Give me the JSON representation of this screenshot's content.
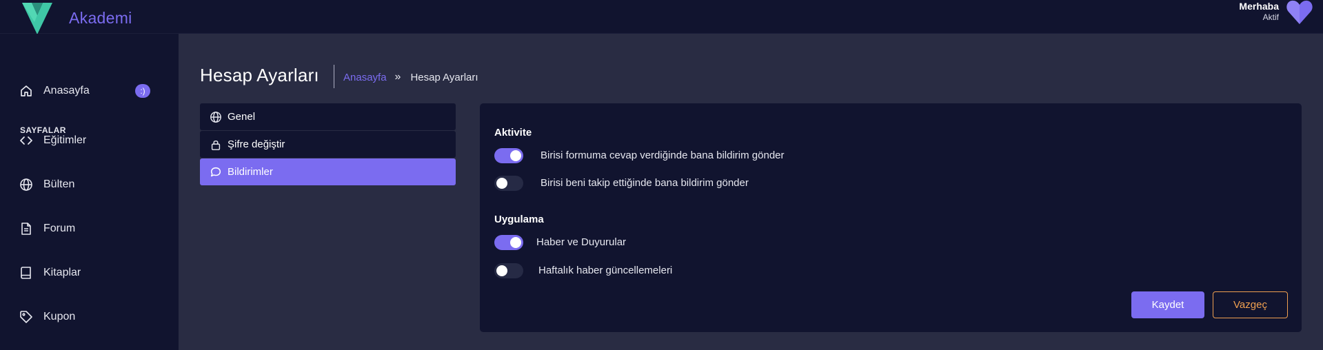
{
  "app": {
    "brand": "Akademi",
    "accent_color": "#7b6cf0",
    "logo_icon": "v-logo-icon"
  },
  "user": {
    "greeting": "Merhaba",
    "status": "Aktif",
    "avatar_icon": "heart-avatar-icon"
  },
  "sidebar": {
    "home": {
      "label": "Anasayfa",
      "badge": ":)",
      "icon": "home-icon"
    },
    "section_title": "SAYFALAR",
    "items": [
      {
        "label": "Eğitimler",
        "icon": "code-icon"
      },
      {
        "label": "Bülten",
        "icon": "globe-icon"
      },
      {
        "label": "Forum",
        "icon": "document-icon"
      },
      {
        "label": "Kitaplar",
        "icon": "book-icon"
      },
      {
        "label": "Kupon",
        "icon": "tag-icon"
      }
    ]
  },
  "header": {
    "title": "Hesap Ayarları",
    "breadcrumb": {
      "home": "Anasayfa",
      "separator": "»",
      "current": "Hesap Ayarları"
    }
  },
  "settings_menu": [
    {
      "label": "Genel",
      "icon": "globe-icon",
      "active": false
    },
    {
      "label": "Şifre değiştir",
      "icon": "lock-icon",
      "active": false
    },
    {
      "label": "Bildirimler",
      "icon": "chat-bubble-icon",
      "active": true
    }
  ],
  "notifications": {
    "groups": [
      {
        "title": "Aktivite",
        "options": [
          {
            "label": "Birisi formuma cevap verdiğinde bana bildirim gönder",
            "enabled": true
          },
          {
            "label": "Birisi beni takip ettiğinde bana bildirim gönder",
            "enabled": false
          }
        ]
      },
      {
        "title": "Uygulama",
        "options": [
          {
            "label": "Haber ve Duyurular",
            "enabled": true
          },
          {
            "label": "Haftalık haber güncellemeleri",
            "enabled": false
          }
        ]
      }
    ],
    "save_label": "Kaydet",
    "cancel_label": "Vazgeç"
  }
}
